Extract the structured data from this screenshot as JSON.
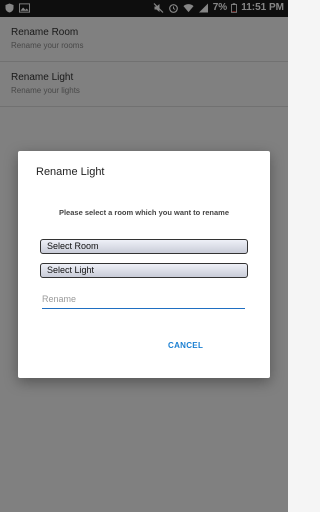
{
  "status_bar": {
    "left_icons": [
      "shield-icon",
      "image-icon"
    ],
    "right_icons": [
      "mute-icon",
      "alarm-icon",
      "wifi-icon",
      "signal-icon",
      "battery-icon"
    ],
    "battery": "7%",
    "time": "11:51 PM"
  },
  "list": {
    "items": [
      {
        "title": "Rename Room",
        "subtitle": "Rename your rooms"
      },
      {
        "title": "Rename Light",
        "subtitle": "Rename your lights"
      }
    ]
  },
  "dialog": {
    "title": "Rename Light",
    "message": "Please select a room which you want to rename",
    "select_room_label": "Select Room",
    "select_light_label": "Select Light",
    "rename_placeholder": "Rename",
    "cancel_label": "CANCEL"
  },
  "colors": {
    "accent": "#1a7fd2",
    "status_bar": "#1c1c1c",
    "scrim": "rgba(0,0,0,0.48)"
  }
}
